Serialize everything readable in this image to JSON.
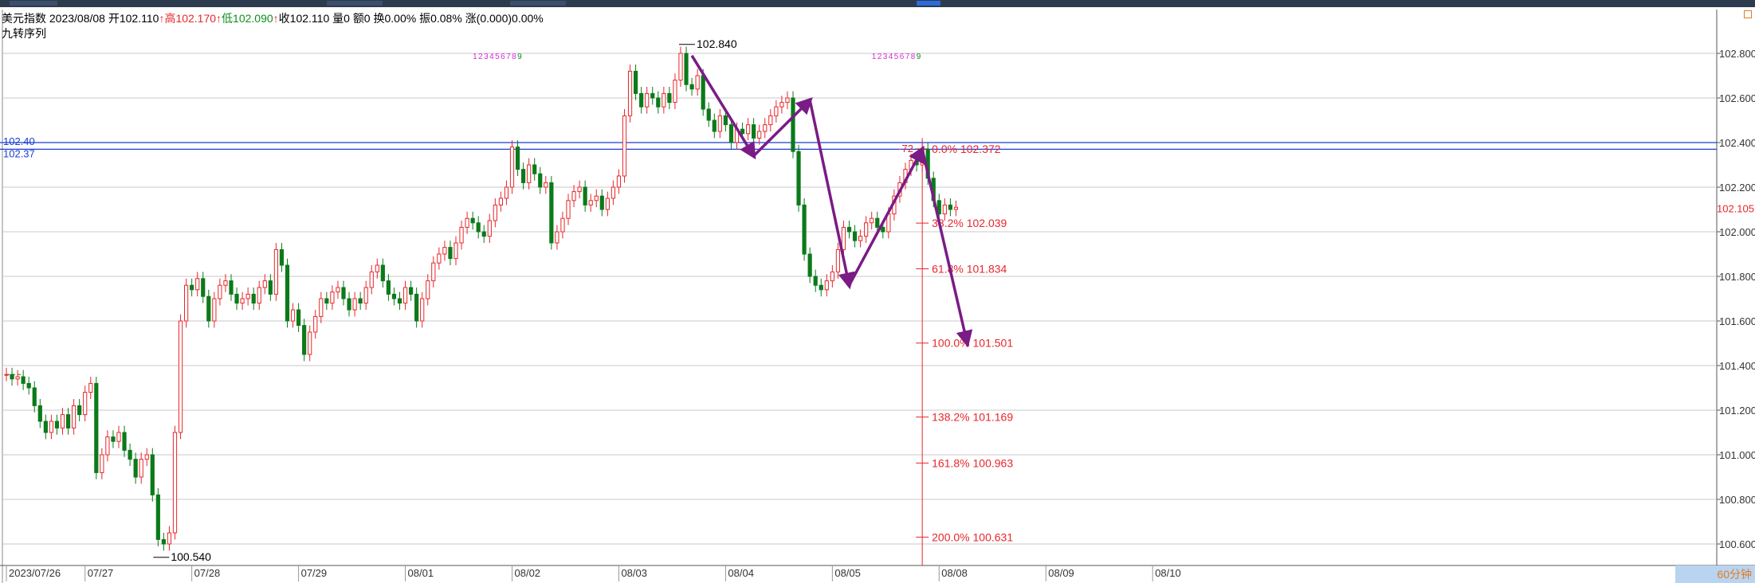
{
  "header": {
    "name": "美元指数",
    "date": "2023/08/08",
    "open_label": "开",
    "open": "102.110",
    "high_label": "高",
    "high": "102.170",
    "low_label": "低",
    "low": "102.090",
    "close_label": "收",
    "close": "102.110",
    "volume": "量0",
    "amount": "额0",
    "turnover": "换0.00%",
    "amplitude": "振0.08%",
    "change": "涨(0.000)0.00%",
    "up_arrow": "↑"
  },
  "indicator_label": "九转序列",
  "period_label": "60分钟",
  "colors": {
    "up": "#e8262b",
    "down": "#0b7a1a",
    "grid": "#c8c8c8",
    "hline": "#1a3ed6",
    "arrow": "#7a1b86",
    "fib": "#e8262b",
    "nine": "#d42fd4"
  },
  "chart_data": {
    "type": "candlestick",
    "title": "美元指数",
    "ylim": [
      100.54,
      102.84
    ],
    "y_ticks": [
      "102.800",
      "102.600",
      "102.400",
      "102.200",
      "102.000",
      "101.800",
      "101.600",
      "101.400",
      "101.200",
      "101.000",
      "100.800",
      "100.600"
    ],
    "y_tick_values": [
      102.8,
      102.6,
      102.4,
      102.2,
      102.0,
      101.8,
      101.6,
      101.4,
      101.2,
      101.0,
      100.8,
      100.6
    ],
    "x_ticks": [
      "2023/07/26",
      "07/27",
      "07/28",
      "07/29",
      "08/01",
      "08/02",
      "08/03",
      "08/04",
      "08/05",
      "08/08",
      "08/09",
      "08/10"
    ],
    "x_tick_index": [
      0,
      14,
      33,
      52,
      71,
      90,
      109,
      128,
      147,
      166,
      185,
      204
    ],
    "current_price_label": "102.105",
    "current_price": 102.105,
    "horizontal_lines": [
      {
        "value": 102.4,
        "label": "102.40"
      },
      {
        "value": 102.37,
        "label": "102.37"
      }
    ],
    "peak": {
      "index": 120,
      "value": 102.84,
      "label": "102.840"
    },
    "trough": {
      "index": 27,
      "value": 100.54,
      "label": "100.540"
    },
    "fibonacci": {
      "anchor_index": 163,
      "start_label": "-72",
      "levels": [
        {
          "pct": "0.0%",
          "value": 102.372
        },
        {
          "pct": "38.2%",
          "value": 102.039
        },
        {
          "pct": "61.8%",
          "value": 101.834
        },
        {
          "pct": "100.0%",
          "value": 101.501
        },
        {
          "pct": "138.2%",
          "value": 101.169
        },
        {
          "pct": "161.8%",
          "value": 100.963
        },
        {
          "pct": "200.0%",
          "value": 100.631
        }
      ]
    },
    "nine_sequences": [
      {
        "start_index": 83,
        "value": 102.79,
        "digits": [
          "1",
          "2",
          "3",
          "4",
          "5",
          "6",
          "7",
          "8",
          "9"
        ]
      },
      {
        "start_index": 154,
        "value": 102.79,
        "digits": [
          "1",
          "2",
          "3",
          "4",
          "5",
          "6",
          "7",
          "8",
          "9"
        ]
      }
    ],
    "arrows": [
      {
        "from": [
          122,
          102.79
        ],
        "to": [
          133,
          102.34
        ]
      },
      {
        "from": [
          133,
          102.34
        ],
        "to": [
          143,
          102.59
        ]
      },
      {
        "from": [
          143,
          102.59
        ],
        "to": [
          150,
          101.76
        ]
      },
      {
        "from": [
          150,
          101.76
        ],
        "to": [
          163,
          102.37
        ]
      },
      {
        "from": [
          163,
          102.37
        ],
        "to": [
          171,
          101.5
        ]
      }
    ],
    "dashed_line": {
      "from_index": 0,
      "to_index": 3,
      "value": 101.36
    },
    "closes": [
      101.36,
      101.34,
      101.35,
      101.32,
      101.3,
      101.22,
      101.15,
      101.1,
      101.15,
      101.12,
      101.18,
      101.12,
      101.22,
      101.18,
      101.28,
      101.32,
      100.92,
      101.0,
      101.08,
      101.06,
      101.1,
      101.02,
      100.98,
      100.9,
      100.98,
      101.0,
      100.82,
      100.62,
      100.6,
      100.65,
      101.1,
      101.6,
      101.76,
      101.74,
      101.79,
      101.71,
      101.6,
      101.7,
      101.76,
      101.78,
      101.72,
      101.68,
      101.7,
      101.72,
      101.68,
      101.75,
      101.78,
      101.72,
      101.92,
      101.85,
      101.6,
      101.65,
      101.58,
      101.45,
      101.55,
      101.62,
      101.7,
      101.68,
      101.73,
      101.75,
      101.7,
      101.65,
      101.7,
      101.68,
      101.75,
      101.82,
      101.85,
      101.78,
      101.72,
      101.7,
      101.68,
      101.75,
      101.72,
      101.6,
      101.7,
      101.78,
      101.86,
      101.9,
      101.93,
      101.88,
      101.95,
      102.02,
      102.06,
      102.04,
      102.0,
      101.98,
      102.05,
      102.12,
      102.15,
      102.2,
      102.38,
      102.28,
      102.22,
      102.3,
      102.26,
      102.2,
      102.22,
      101.95,
      102.0,
      102.06,
      102.14,
      102.18,
      102.2,
      102.12,
      102.14,
      102.16,
      102.1,
      102.15,
      102.2,
      102.25,
      102.52,
      102.72,
      102.62,
      102.56,
      102.62,
      102.6,
      102.56,
      102.62,
      102.58,
      102.68,
      102.8,
      102.66,
      102.64,
      102.7,
      102.55,
      102.5,
      102.45,
      102.52,
      102.48,
      102.4,
      102.46,
      102.44,
      102.48,
      102.42,
      102.45,
      102.48,
      102.52,
      102.56,
      102.58,
      102.6,
      102.36,
      102.12,
      101.9,
      101.8,
      101.76,
      101.74,
      101.78,
      101.82,
      101.92,
      102.02,
      102.0,
      101.96,
      101.98,
      102.04,
      102.06,
      102.02,
      102.0,
      102.08,
      102.16,
      102.22,
      102.28,
      102.32,
      102.3,
      102.37,
      102.24,
      102.14,
      102.08,
      102.12,
      102.1,
      102.11
    ]
  }
}
